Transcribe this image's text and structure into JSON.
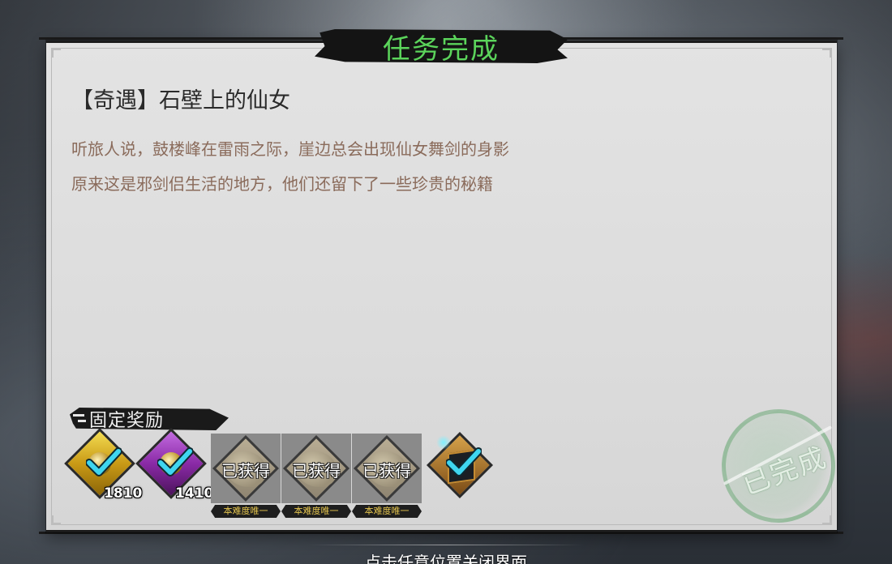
{
  "dialog": {
    "title": "任务完成",
    "quest_name": "【奇遇】石壁上的仙女",
    "description_lines": [
      "听旅人说，鼓楼峰在雷雨之际，崖边总会出现仙女舞剑的身影",
      "原来这是邪剑侣生活的地方，他们还留下了一些珍贵的秘籍"
    ]
  },
  "rewards": {
    "label": "固定奖励",
    "items": [
      {
        "icon": "gold-coin-icon",
        "count": "1810",
        "claimed": true
      },
      {
        "icon": "purple-gem-icon",
        "count": "1410",
        "claimed": true
      },
      {
        "icon": "item-icon",
        "status": "已获得",
        "tag": "本难度唯一"
      },
      {
        "icon": "item-icon",
        "status": "已获得",
        "tag": "本难度唯一"
      },
      {
        "icon": "item-icon",
        "status": "已获得",
        "tag": "本难度唯一"
      },
      {
        "icon": "book-icon",
        "claimed": true
      }
    ]
  },
  "stamp": {
    "text": "已完成"
  },
  "footer": {
    "close_hint": "点击任意位置关闭界面"
  },
  "colors": {
    "title_green": "#5bd45b",
    "desc_brown": "#8a6b5b",
    "check_cyan": "#3fd6f0",
    "tag_gold": "#e6c64f"
  }
}
